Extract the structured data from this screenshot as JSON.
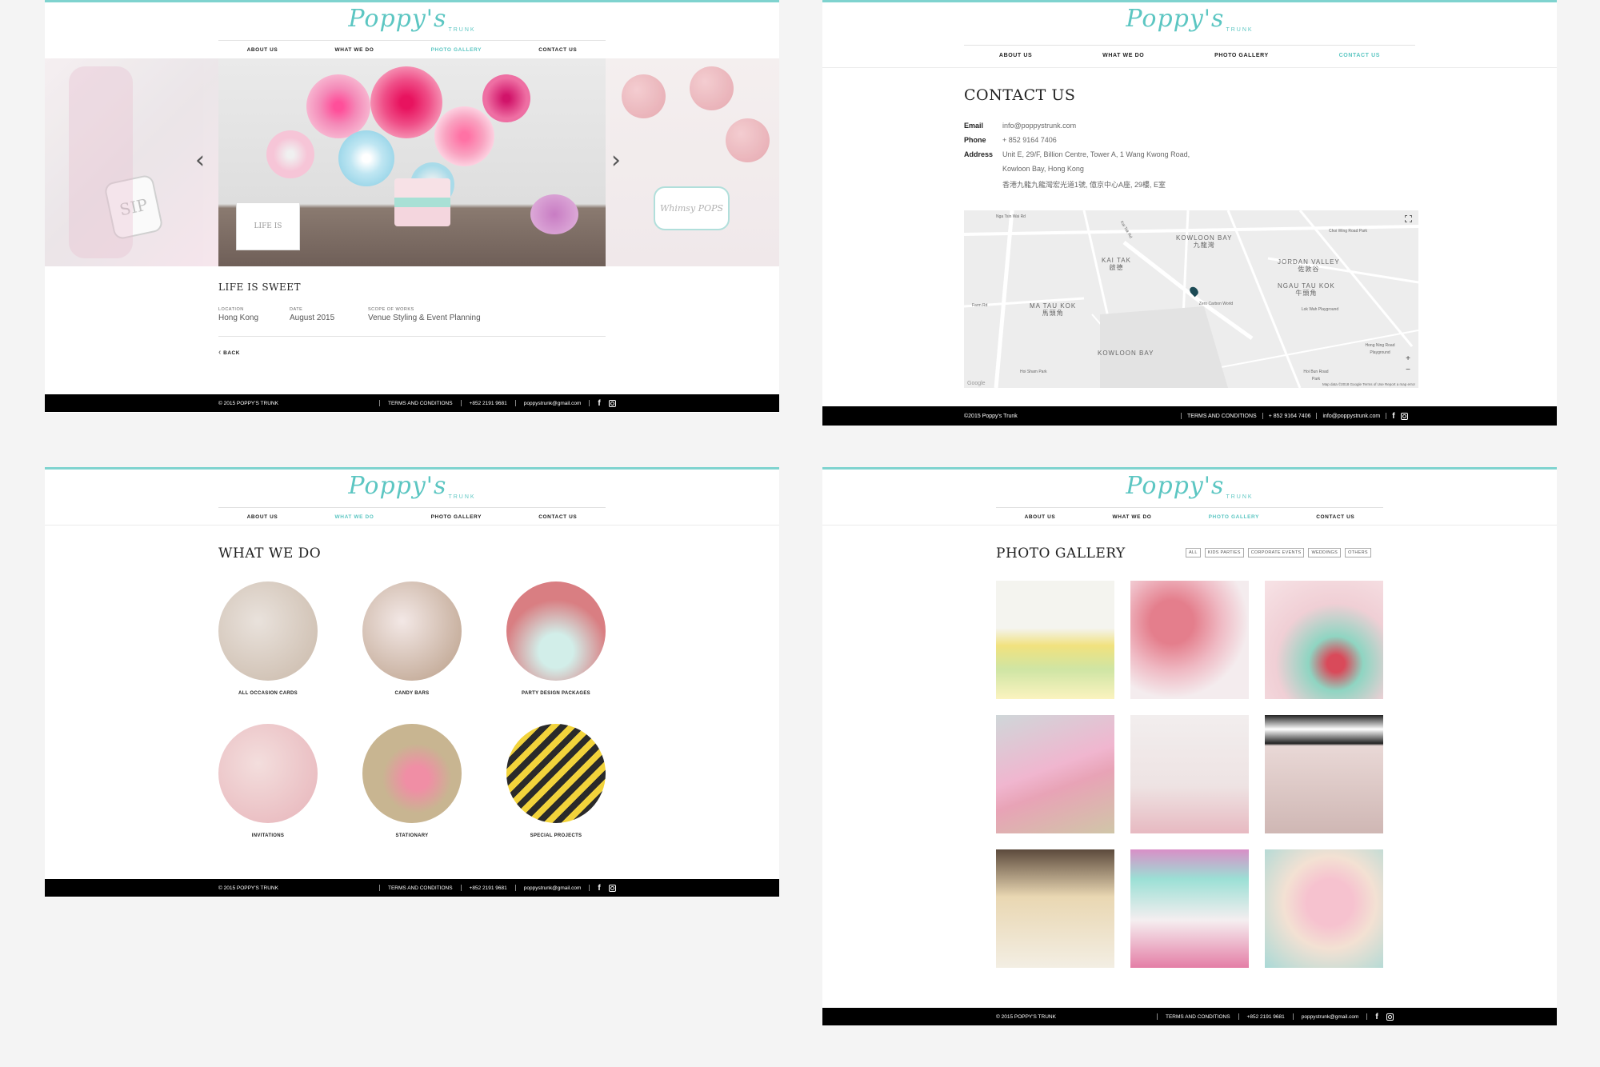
{
  "brand": {
    "logo_script": "Poppy's",
    "logo_sub": "TRUNK",
    "accent": "#5cc6c2",
    "footer_bg": "#000000"
  },
  "nav": {
    "about": "ABOUT US",
    "what": "WHAT WE DO",
    "gallery": "PHOTO GALLERY",
    "contact": "CONTACT US"
  },
  "panel1": {
    "title": "LIFE IS SWEET",
    "location_label": "LOCATION",
    "location": "Hong Kong",
    "date_label": "DATE",
    "date": "August 2015",
    "scope_label": "SCOPE OF WORKS",
    "scope": "Venue Styling & Event Planning",
    "back": "BACK",
    "prev_icon": "‹",
    "next_icon": "›",
    "slide_left_text": "SIP",
    "slide_center_card": "LIFE IS",
    "slide_right_card": "Whimsy POPS",
    "footer": {
      "copy": "© 2015 POPPY'S TRUNK",
      "terms": "TERMS AND CONDITIONS",
      "phone": "+852 2191 9681",
      "email": "poppystrunk@gmail.com"
    }
  },
  "panel2": {
    "title": "CONTACT US",
    "email_label": "Email",
    "email": "info@poppystrunk.com",
    "phone_label": "Phone",
    "phone": "+ 852 9164 7406",
    "address_label": "Address",
    "address1": "Unit E, 29/F, Billion Centre, Tower A, 1 Wang Kwong Road,",
    "address2": "Kowloon Bay, Hong Kong",
    "address3": "香港九龍九龍灣宏光道1號, 億京中心A座, 29樓, E室",
    "map": {
      "labels": [
        {
          "en": "KOWLOON BAY",
          "zh": "九龍灣"
        },
        {
          "en": "KAI TAK",
          "zh": "啟德"
        },
        {
          "en": "JORDAN VALLEY",
          "zh": "佐敦谷"
        },
        {
          "en": "NGAU TAU KOK",
          "zh": "牛頭角"
        },
        {
          "en": "MA TAU KOK",
          "zh": "馬頭角"
        },
        {
          "en": "KOWLOON BAY",
          "zh": ""
        }
      ],
      "streets": [
        "Nga Tsin Wai Rd",
        "Kai Tak Rd",
        "Choi Wing Road Park",
        "Zero Carbon World",
        "Lok Wah Playground",
        "Hong Ning Road Playground",
        "Hoi Sham Park",
        "Hoi Bun Road Park",
        "Farm Rd"
      ],
      "attribution": "Map data ©2018 Google   Terms of Use   Report a map error",
      "google": "Google"
    },
    "footer": {
      "copy": "©2015 Poppy's Trunk",
      "terms": "TERMS AND CONDITIONS",
      "phone": "+ 852 9164 7406",
      "email": "info@poppystrunk.com"
    }
  },
  "panel3": {
    "title": "WHAT WE DO",
    "items": [
      {
        "label": "ALL OCCASION CARDS",
        "color": "#c9b8a8"
      },
      {
        "label": "CANDY BARS",
        "color": "#b89c85"
      },
      {
        "label": "PARTY DESIGN PACKAGES",
        "color": "#d97e82"
      },
      {
        "label": "INVITATIONS",
        "color": "#e7b3b9"
      },
      {
        "label": "STATIONARY",
        "color": "#c8b591"
      },
      {
        "label": "SPECIAL PROJECTS",
        "color": "#d6564c"
      }
    ],
    "footer": {
      "copy": "© 2015 POPPY'S TRUNK",
      "terms": "TERMS AND CONDITIONS",
      "phone": "+852 2191 9681",
      "email": "poppystrunk@gmail.com"
    }
  },
  "panel4": {
    "title": "PHOTO GALLERY",
    "filters": [
      "ALL",
      "KIDS PARTIES",
      "CORPORATE EVENTS",
      "WEDDINGS",
      "OTHERS"
    ],
    "footer": {
      "copy": "© 2015 POPPY'S TRUNK",
      "terms": "TERMS AND CONDITIONS",
      "phone": "+852 2191 9681",
      "email": "poppystrunk@gmail.com"
    }
  }
}
